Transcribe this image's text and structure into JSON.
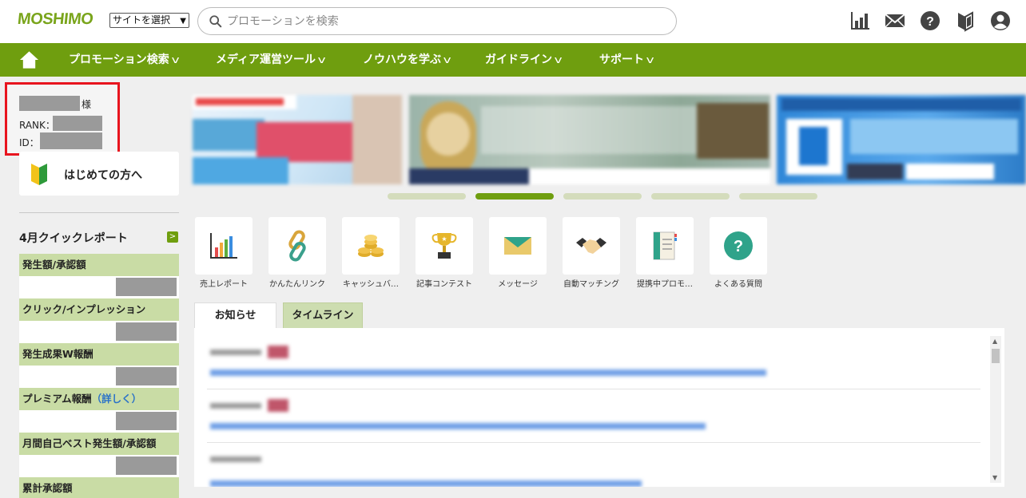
{
  "header": {
    "logo": "MOSHIMO",
    "site_select": "サイトを選択",
    "search_placeholder": "プロモーションを検索",
    "icons": [
      "report-chart-icon",
      "mail-icon",
      "help-icon",
      "beginner-mark-icon",
      "user-account-icon"
    ]
  },
  "nav": {
    "home_icon": "home-icon",
    "items": [
      "プロモーション検索",
      "メディア運営ツール",
      "ノウハウを学ぶ",
      "ガイドライン",
      "サポート"
    ]
  },
  "user": {
    "honorific": "様",
    "rank_label": "RANK：",
    "id_label": "ID："
  },
  "first_visit": {
    "label": "はじめての方へ"
  },
  "quick_report": {
    "title": "4月クイックレポート",
    "metrics": [
      "発生額/承認額",
      "クリック/インプレッション",
      "発生成果W報酬",
      "プレミアム報酬",
      "月間自己ベスト発生額/承認額",
      "累計承認額"
    ],
    "premium_link": "（詳しく）"
  },
  "banner": {
    "slides": 5,
    "active_slide": 2
  },
  "quick_links": [
    "売上レポート",
    "かんたんリンク",
    "キャッシュバ…",
    "記事コンテスト",
    "メッセージ",
    "自動マッチング",
    "提携中プロモ…",
    "よくある質問"
  ],
  "tabs": [
    "お知らせ",
    "タイムライン"
  ],
  "colors": {
    "brand_green": "#6f9e0f",
    "metric_bg": "#c9dca5",
    "highlight_red": "#e8141e"
  }
}
